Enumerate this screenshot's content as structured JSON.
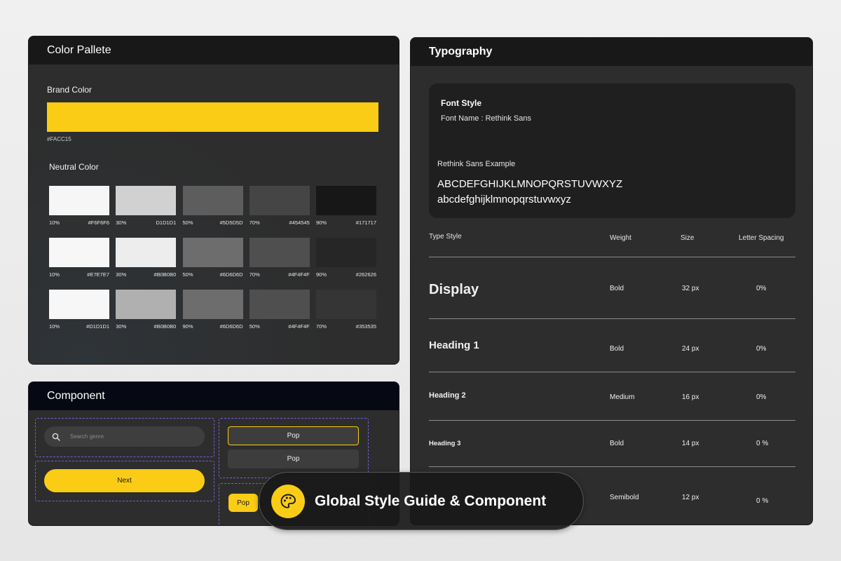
{
  "palette": {
    "title": "Color Pallete",
    "brand_label": "Brand Color",
    "brand_color": "#FACC15",
    "brand_hex": "#FACC15",
    "neutral_label": "Neutral Color",
    "rows": [
      [
        {
          "pct": "10%",
          "hex": "#F6F6F6",
          "color": "#F6F6F6"
        },
        {
          "pct": "30%",
          "hex": "D1D1D1",
          "color": "#D1D1D1"
        },
        {
          "pct": "50%",
          "hex": "#5D5D5D",
          "color": "#5D5D5D"
        },
        {
          "pct": "70%",
          "hex": "#454545",
          "color": "#454545"
        },
        {
          "pct": "90%",
          "hex": "#171717",
          "color": "#171717"
        }
      ],
      [
        {
          "pct": "10%",
          "hex": "#E7E7E7",
          "color": "#F7F7F7"
        },
        {
          "pct": "30%",
          "hex": "#B0B0B0",
          "color": "#EDEDED"
        },
        {
          "pct": "50%",
          "hex": "#6D6D6D",
          "color": "#6D6D6D"
        },
        {
          "pct": "70%",
          "hex": "#4F4F4F",
          "color": "#4F4F4F"
        },
        {
          "pct": "90%",
          "hex": "#262626",
          "color": "#262626"
        }
      ],
      [
        {
          "pct": "10%",
          "hex": "#D1D1D1",
          "color": "#F7F7F7"
        },
        {
          "pct": "30%",
          "hex": "#B0B0B0",
          "color": "#B0B0B0"
        },
        {
          "pct": "90%",
          "hex": "#6D6D6D",
          "color": "#6D6D6D"
        },
        {
          "pct": "50%",
          "hex": "#4F4F4F",
          "color": "#4F4F4F"
        },
        {
          "pct": "70%",
          "hex": "#353535",
          "color": "#353535"
        }
      ]
    ]
  },
  "component": {
    "title": "Component",
    "search_placeholder": "Search genre",
    "search_icon": "search-icon",
    "next_label": "Next",
    "pop_label_1": "Pop",
    "pop_label_2": "Pop",
    "pop_chip_label": "Pop"
  },
  "typography": {
    "title": "Typography",
    "font_style_label": "Font Style",
    "font_name": "Font Name : Rethink Sans",
    "example_label": "Rethink Sans Example",
    "uppercase": "ABCDEFGHIJKLMNOPQRSTUVWXYZ",
    "lowercase": "abcdefghijklmnopqrstuvwxyz",
    "headers": {
      "type": "Type Style",
      "weight": "Weight",
      "size": "Size",
      "spacing": "Letter Spacing"
    },
    "rows": [
      {
        "name": "Display",
        "weight": "Bold",
        "size": "32 px",
        "spacing": "0%"
      },
      {
        "name": "Heading 1",
        "weight": "Bold",
        "size": "24 px",
        "spacing": "0%"
      },
      {
        "name": "Heading 2",
        "weight": "Medium",
        "size": "16 px",
        "spacing": "0%"
      },
      {
        "name": "Heading 3",
        "weight": "Bold",
        "size": "14 px",
        "spacing": "0 %"
      },
      {
        "name": "",
        "weight": "Semibold",
        "size": "12 px",
        "spacing": "0 %"
      }
    ]
  },
  "badge": {
    "title": "Global Style Guide & Component",
    "icon": "palette-icon"
  }
}
